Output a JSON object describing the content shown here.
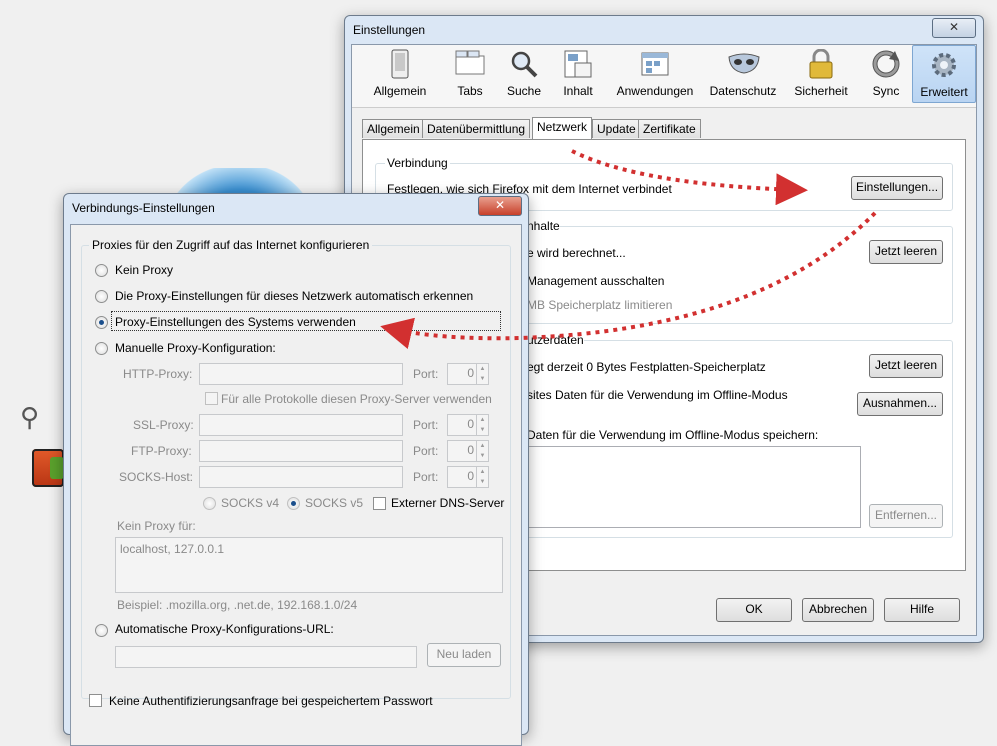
{
  "main_window": {
    "title": "Einstellungen",
    "toolbar": [
      {
        "label": "Allgemein",
        "icon": "switch-icon"
      },
      {
        "label": "Tabs",
        "icon": "tabs-icon"
      },
      {
        "label": "Suche",
        "icon": "magnifier-icon"
      },
      {
        "label": "Inhalt",
        "icon": "content-icon"
      },
      {
        "label": "Anwendungen",
        "icon": "applications-icon"
      },
      {
        "label": "Datenschutz",
        "icon": "mask-icon"
      },
      {
        "label": "Sicherheit",
        "icon": "lock-icon"
      },
      {
        "label": "Sync",
        "icon": "sync-icon"
      },
      {
        "label": "Erweitert",
        "icon": "gear-icon",
        "selected": true
      }
    ],
    "tabs": [
      "Allgemein",
      "Datenübermittlung",
      "Netzwerk",
      "Update",
      "Zertifikate"
    ],
    "selected_tab": "Netzwerk",
    "connection": {
      "title": "Verbindung",
      "description": "Festlegen, wie sich Firefox mit dem Internet verbindet",
      "button": "Einstellungen..."
    },
    "cache": {
      "title_fragment": "nhalte",
      "line1": "e wird berechnet...",
      "line2": "Management ausschalten",
      "line3": "MB Speicherplatz limitieren",
      "button": "Jetzt leeren"
    },
    "offline": {
      "title_fragment": "utzerdaten",
      "line1": "egt derzeit 0 Bytes Festplatten-Speicherplatz",
      "line2": "sites Daten für die Verwendung im Offline-Modus",
      "line3": "Daten für die Verwendung im Offline-Modus speichern:",
      "clear_button": "Jetzt leeren",
      "exceptions_button": "Ausnahmen...",
      "remove_button": "Entfernen..."
    },
    "footer": {
      "ok": "OK",
      "cancel": "Abbrechen",
      "help": "Hilfe"
    }
  },
  "dialog": {
    "title": "Verbindungs-Einstellungen",
    "group_title": "Proxies für den Zugriff auf das Internet konfigurieren",
    "options": {
      "no_proxy": "Kein Proxy",
      "auto_detect": "Die Proxy-Einstellungen für dieses Netzwerk automatisch erkennen",
      "system": "Proxy-Einstellungen des Systems verwenden",
      "manual": "Manuelle Proxy-Konfiguration:"
    },
    "selected_option": "system",
    "http_proxy_label": "HTTP-Proxy:",
    "port_label": "Port:",
    "port_value": "0",
    "all_protocols_label": "Für alle Protokolle diesen Proxy-Server verwenden",
    "ssl_label": "SSL-Proxy:",
    "ftp_label": "FTP-Proxy:",
    "socks_label": "SOCKS-Host:",
    "socks4": "SOCKS v4",
    "socks5": "SOCKS v5",
    "remote_dns": "Externer DNS-Server",
    "no_proxy_for_label": "Kein Proxy für:",
    "no_proxy_for_value": "localhost, 127.0.0.1",
    "example": "Beispiel: .mozilla.org, .net.de, 192.168.1.0/24",
    "auto_url_label": "Automatische Proxy-Konfigurations-URL:",
    "reload_button": "Neu laden",
    "no_auth_prompt": "Keine Authentifizierungsanfrage bei gespeichertem Passwort"
  },
  "colors": {
    "arrow": "#d23030",
    "selection": "#1b4f8c"
  }
}
